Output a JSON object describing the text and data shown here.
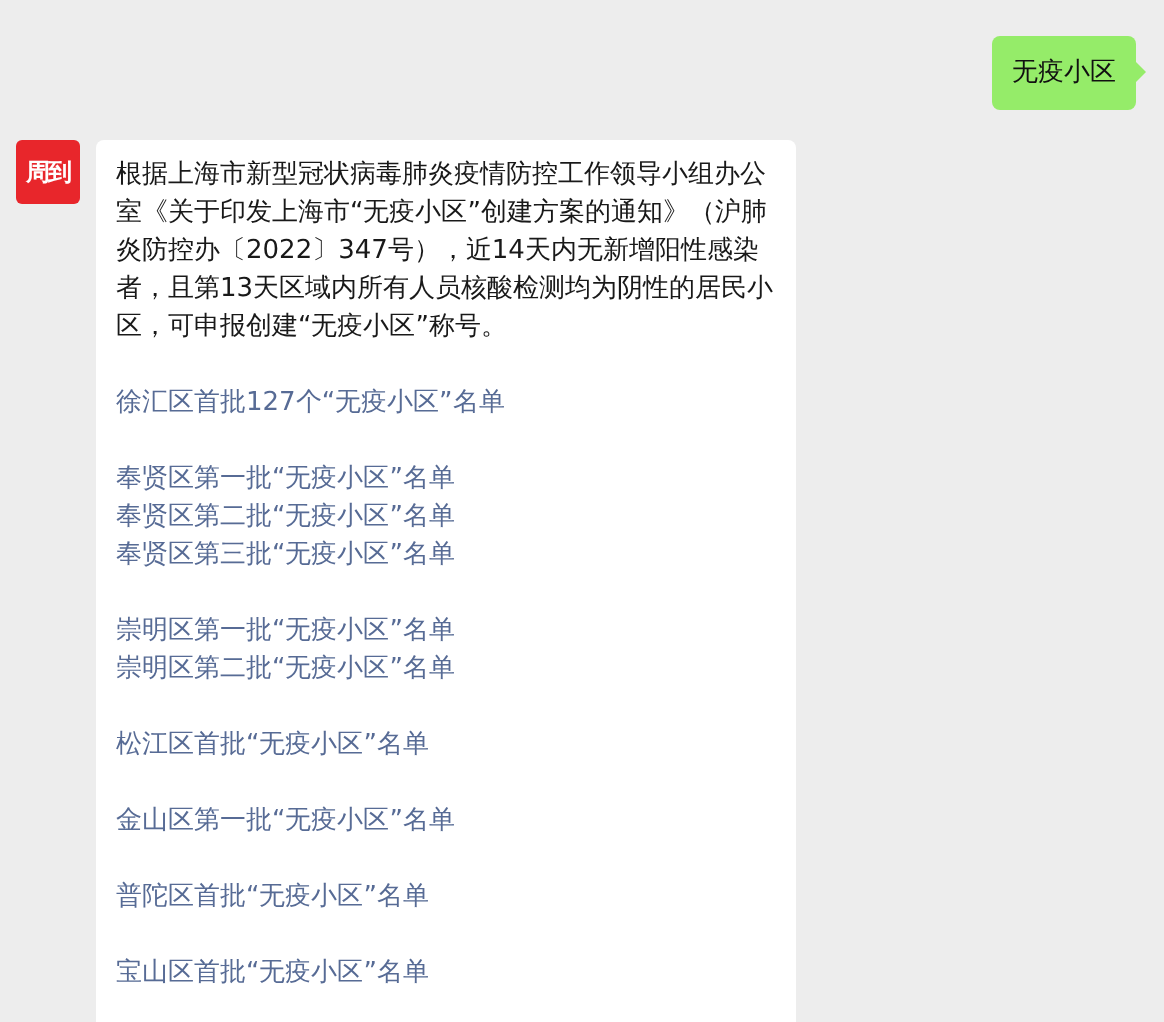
{
  "messages": [
    {
      "kind": "outgoing",
      "text": "无疫小区"
    },
    {
      "kind": "incoming",
      "avatar": "周到",
      "text": "根据上海市新型冠状病毒肺炎疫情防控工作领导小组办公室《关于印发上海市“无疫小区”创建方案的通知》（沪肺炎防控办〔2022〕347号），近14天内无新增阳性感染者，且第13天区域内所有人员核酸检测均为阴性的居民小区，可申报创建“无疫小区”称号。",
      "link_groups": [
        [
          "徐汇区首批127个“无疫小区”名单"
        ],
        [
          "奉贤区第一批“无疫小区”名单",
          "奉贤区第二批“无疫小区”名单",
          "奉贤区第三批“无疫小区”名单"
        ],
        [
          "崇明区第一批“无疫小区”名单",
          "崇明区第二批“无疫小区”名单"
        ],
        [
          "松江区首批“无疫小区”名单"
        ],
        [
          "金山区第一批“无疫小区”名单"
        ],
        [
          "普陀区首批“无疫小区”名单"
        ],
        [
          "宝山区首批“无疫小区”名单"
        ]
      ]
    }
  ]
}
